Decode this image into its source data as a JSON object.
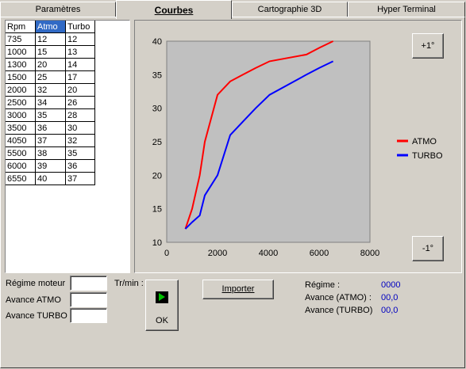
{
  "tabs": [
    {
      "label": "Paramètres",
      "active": false
    },
    {
      "label": "Courbes",
      "active": true
    },
    {
      "label": "Cartographie 3D",
      "active": false
    },
    {
      "label": "Hyper Terminal",
      "active": false
    }
  ],
  "table": {
    "headers": [
      "Rpm",
      "Atmo",
      "Turbo"
    ],
    "rows": [
      [
        "735",
        "12",
        "12"
      ],
      [
        "1000",
        "15",
        "13"
      ],
      [
        "1300",
        "20",
        "14"
      ],
      [
        "1500",
        "25",
        "17"
      ],
      [
        "2000",
        "32",
        "20"
      ],
      [
        "2500",
        "34",
        "26"
      ],
      [
        "3000",
        "35",
        "28"
      ],
      [
        "3500",
        "36",
        "30"
      ],
      [
        "4050",
        "37",
        "32"
      ],
      [
        "5500",
        "38",
        "35"
      ],
      [
        "6000",
        "39",
        "36"
      ],
      [
        "6550",
        "40",
        "37"
      ]
    ]
  },
  "buttons": {
    "plus": "+1°",
    "minus": "-1°",
    "import": "Importer",
    "ok": "OK"
  },
  "form": {
    "regime_label": "Régime moteur",
    "trmin_label": "Tr/min :",
    "atmo_label": "Avance ATMO",
    "turbo_label": "Avance TURBO"
  },
  "readout": {
    "regime_label": "Régime :",
    "regime_value": "0000",
    "atmo_label": "Avance (ATMO) :",
    "atmo_value": "00,0",
    "turbo_label": "Avance (TURBO)",
    "turbo_value": "00,0"
  },
  "colors": {
    "atmo": "#ff0000",
    "turbo": "#0000ff",
    "plot_bg": "#c0c0c0",
    "play_green": "#00c000"
  },
  "chart_data": {
    "type": "line",
    "xlim": [
      0,
      8000
    ],
    "ylim": [
      10,
      40
    ],
    "x_ticks": [
      "0",
      "2000",
      "4000",
      "6000",
      "8000"
    ],
    "y_ticks": [
      "10",
      "15",
      "20",
      "25",
      "30",
      "35",
      "40"
    ],
    "legend_position": "right",
    "series": [
      {
        "name": "ATMO",
        "color": "#ff0000",
        "x": [
          735,
          1000,
          1300,
          1500,
          2000,
          2500,
          3000,
          3500,
          4050,
          5500,
          6000,
          6550
        ],
        "y": [
          12,
          15,
          20,
          25,
          32,
          34,
          35,
          36,
          37,
          38,
          39,
          40
        ]
      },
      {
        "name": "TURBO",
        "color": "#0000ff",
        "x": [
          735,
          1000,
          1300,
          1500,
          2000,
          2500,
          3000,
          3500,
          4050,
          5500,
          6000,
          6550
        ],
        "y": [
          12,
          13,
          14,
          17,
          20,
          26,
          28,
          30,
          32,
          35,
          36,
          37
        ]
      }
    ]
  }
}
